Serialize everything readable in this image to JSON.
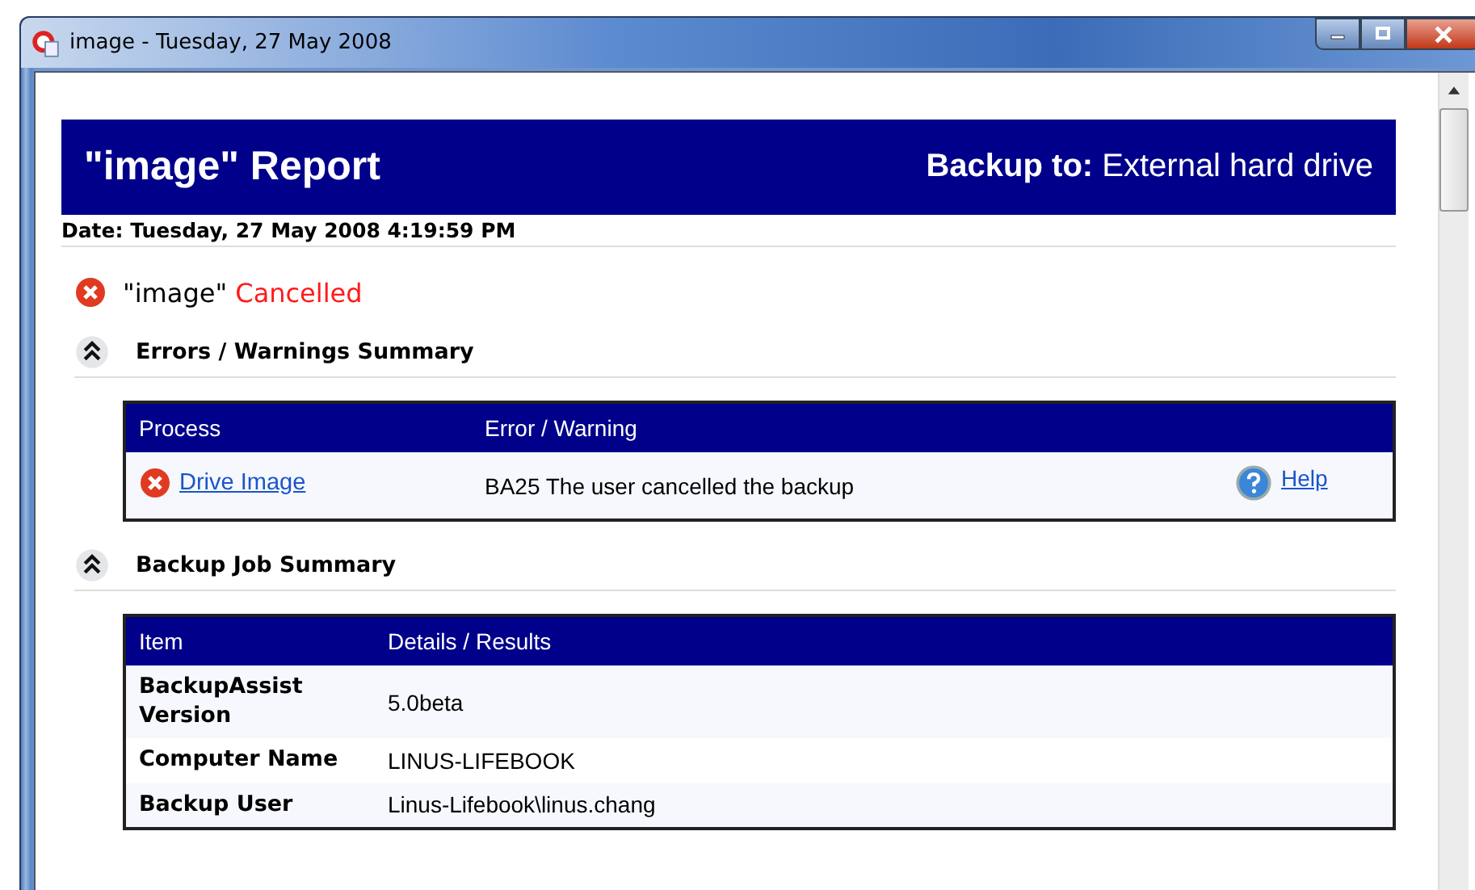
{
  "window": {
    "title": "image - Tuesday, 27 May 2008"
  },
  "report": {
    "title": "\"image\" Report",
    "destination_label": "Backup to:",
    "destination": "External hard drive",
    "date": "Date: Tuesday, 27 May 2008 4:19:59 PM"
  },
  "status": {
    "job": "\"image\"",
    "result": "Cancelled",
    "kind": "error"
  },
  "sections": [
    {
      "title": "Errors / Warnings Summary",
      "expanded": true,
      "kind": "errors",
      "columns": [
        "Process",
        "Error / Warning"
      ],
      "rows": [
        {
          "process": "Drive Image",
          "kind": "error",
          "message": "BA25 The user cancelled the backup",
          "help": "Help"
        }
      ]
    },
    {
      "title": "Backup Job Summary",
      "expanded": true,
      "kind": "details",
      "columns": [
        "Item",
        "Details / Results"
      ],
      "rows": [
        {
          "item": "BackupAssist Version",
          "value": "5.0beta"
        },
        {
          "item": "Computer Name",
          "value": "LINUS-LIFEBOOK"
        },
        {
          "item": "Backup User",
          "value": "Linus-Lifebook\\linus.chang"
        }
      ]
    }
  ]
}
